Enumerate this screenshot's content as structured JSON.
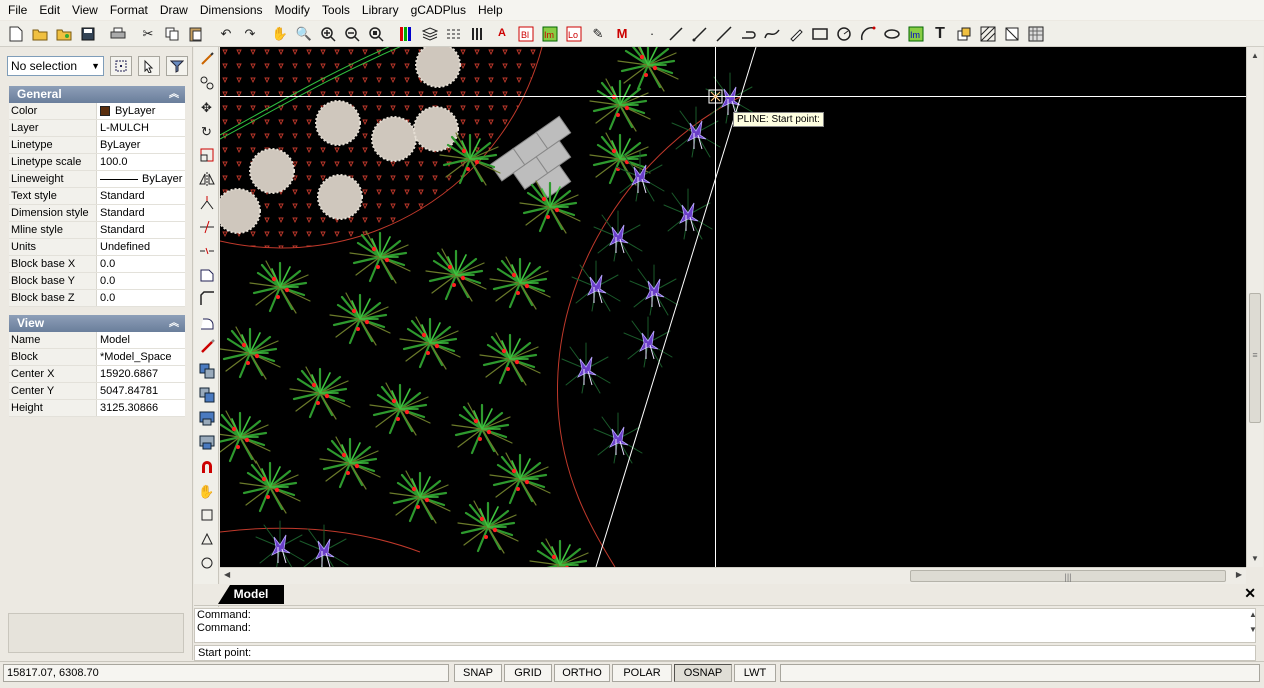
{
  "menu": [
    "File",
    "Edit",
    "View",
    "Format",
    "Draw",
    "Dimensions",
    "Modify",
    "Tools",
    "Library",
    "gCADPlus",
    "Help"
  ],
  "toolbar_icons": [
    "new-icon",
    "open-icon",
    "open-template-icon",
    "save-icon",
    "print-icon",
    "cut-icon",
    "copy-icon",
    "paste-icon",
    "undo-icon",
    "redo-icon",
    "pan-icon",
    "zoom-realtime-icon",
    "zoom-in-icon",
    "zoom-out-icon",
    "zoom-extents-icon",
    "color-icon",
    "layers-icon",
    "linetype-icon",
    "lineweight-icon",
    "text-style-icon",
    "block-icon",
    "image-icon",
    "layout-icon",
    "pen-icon",
    "multiline-icon",
    "point-icon",
    "line-icon",
    "ray-icon",
    "xline-icon",
    "polyline-icon",
    "spline-icon",
    "eraser-icon",
    "rectangle-icon",
    "circle-icon",
    "arc-icon",
    "ellipse-icon",
    "image-insert-icon",
    "text-icon",
    "insert-block-icon",
    "hatch-icon",
    "wipeout-icon",
    "raster-icon"
  ],
  "selection": {
    "value": "No selection"
  },
  "general": {
    "title": "General",
    "rows": [
      {
        "k": "Color",
        "v": "ByLayer"
      },
      {
        "k": "Layer",
        "v": "L-MULCH"
      },
      {
        "k": "Linetype",
        "v": "ByLayer"
      },
      {
        "k": "Linetype scale",
        "v": "100.0"
      },
      {
        "k": "Lineweight",
        "v": "ByLayer"
      },
      {
        "k": "Text style",
        "v": "Standard"
      },
      {
        "k": "Dimension style",
        "v": "Standard"
      },
      {
        "k": "Mline style",
        "v": "Standard"
      },
      {
        "k": "Units",
        "v": "Undefined"
      },
      {
        "k": "Block base X",
        "v": "0.0"
      },
      {
        "k": "Block base Y",
        "v": "0.0"
      },
      {
        "k": "Block base Z",
        "v": "0.0"
      }
    ]
  },
  "view": {
    "title": "View",
    "rows": [
      {
        "k": "Name",
        "v": "Model"
      },
      {
        "k": "Block",
        "v": "*Model_Space"
      },
      {
        "k": "Center X",
        "v": "15920.6867"
      },
      {
        "k": "Center Y",
        "v": "5047.84781"
      },
      {
        "k": "Height",
        "v": "3125.30866"
      }
    ]
  },
  "tooltip": "PLINE: Start point:",
  "tab": "Model",
  "command": {
    "lines": [
      "Command:",
      "Command:"
    ],
    "prompt": "Start point:"
  },
  "status": {
    "coords": "15817.07,  6308.70",
    "buttons": [
      "SNAP",
      "GRID",
      "ORTHO",
      "POLAR",
      "OSNAP",
      "LWT"
    ],
    "active": "OSNAP"
  }
}
